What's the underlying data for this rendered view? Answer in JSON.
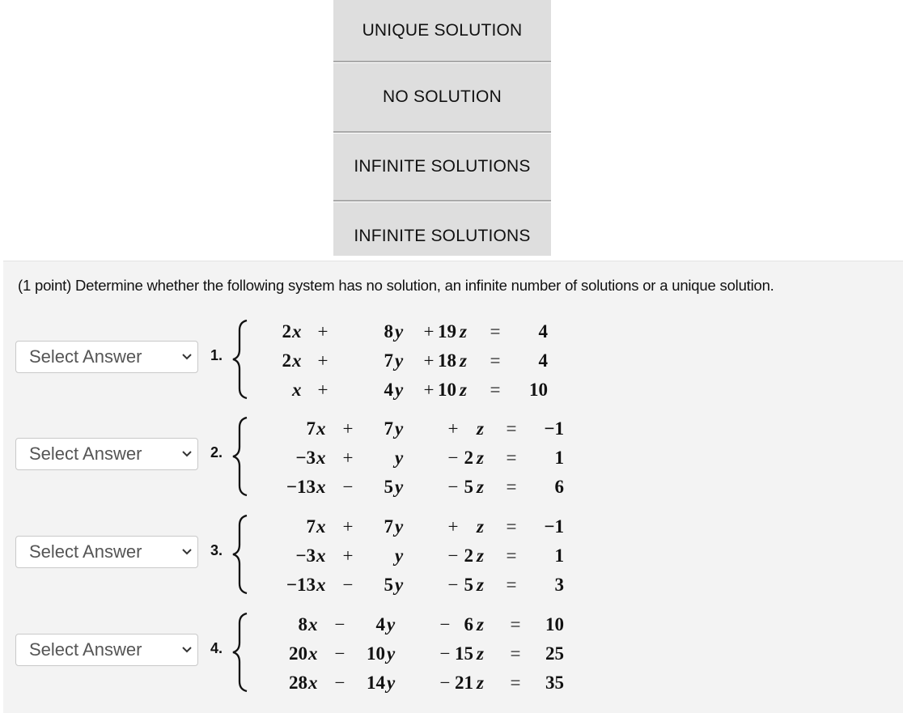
{
  "answer_bank": [
    "UNIQUE SOLUTION",
    "NO SOLUTION",
    "INFINITE SOLUTIONS",
    "INFINITE SOLUTIONS"
  ],
  "prompt": "(1 point) Determine whether the following system has no solution, an infinite number of solutions or a unique solution.",
  "select_placeholder": "Select Answer",
  "problems": [
    {
      "number": "1.",
      "rows": [
        {
          "a": "2",
          "x": "x",
          "o1": "+",
          "b": "8",
          "y": "y",
          "o2": "+",
          "c": "19",
          "z": "z",
          "eq": "=",
          "rhs": "4"
        },
        {
          "a": "2",
          "x": "x",
          "o1": "+",
          "b": "7",
          "y": "y",
          "o2": "+",
          "c": "18",
          "z": "z",
          "eq": "=",
          "rhs": "4"
        },
        {
          "a": "",
          "x": "x",
          "o1": "+",
          "b": "4",
          "y": "y",
          "o2": "+",
          "c": "10",
          "z": "z",
          "eq": "=",
          "rhs": "10"
        }
      ]
    },
    {
      "number": "2.",
      "rows": [
        {
          "a": "7",
          "x": "x",
          "o1": "+",
          "b": "7",
          "y": "y",
          "o2": "+",
          "c": "",
          "z": "z",
          "eq": "=",
          "rhs": "−1"
        },
        {
          "a": "−3",
          "x": "x",
          "o1": "+",
          "b": "",
          "y": "y",
          "o2": "−",
          "c": "2",
          "z": "z",
          "eq": "=",
          "rhs": "1"
        },
        {
          "a": "−13",
          "x": "x",
          "o1": "−",
          "b": "5",
          "y": "y",
          "o2": "−",
          "c": "5",
          "z": "z",
          "eq": "=",
          "rhs": "6"
        }
      ]
    },
    {
      "number": "3.",
      "rows": [
        {
          "a": "7",
          "x": "x",
          "o1": "+",
          "b": "7",
          "y": "y",
          "o2": "+",
          "c": "",
          "z": "z",
          "eq": "=",
          "rhs": "−1"
        },
        {
          "a": "−3",
          "x": "x",
          "o1": "+",
          "b": "",
          "y": "y",
          "o2": "−",
          "c": "2",
          "z": "z",
          "eq": "=",
          "rhs": "1"
        },
        {
          "a": "−13",
          "x": "x",
          "o1": "−",
          "b": "5",
          "y": "y",
          "o2": "−",
          "c": "5",
          "z": "z",
          "eq": "=",
          "rhs": "3"
        }
      ]
    },
    {
      "number": "4.",
      "rows": [
        {
          "a": "8",
          "x": "x",
          "o1": "−",
          "b": "4",
          "y": "y",
          "o2": "−",
          "c": "6",
          "z": "z",
          "eq": "=",
          "rhs": "10"
        },
        {
          "a": "20",
          "x": "x",
          "o1": "−",
          "b": "10",
          "y": "y",
          "o2": "−",
          "c": "15",
          "z": "z",
          "eq": "=",
          "rhs": "25"
        },
        {
          "a": "28",
          "x": "x",
          "o1": "−",
          "b": "14",
          "y": "y",
          "o2": "−",
          "c": "21",
          "z": "z",
          "eq": "=",
          "rhs": "35"
        }
      ]
    }
  ]
}
